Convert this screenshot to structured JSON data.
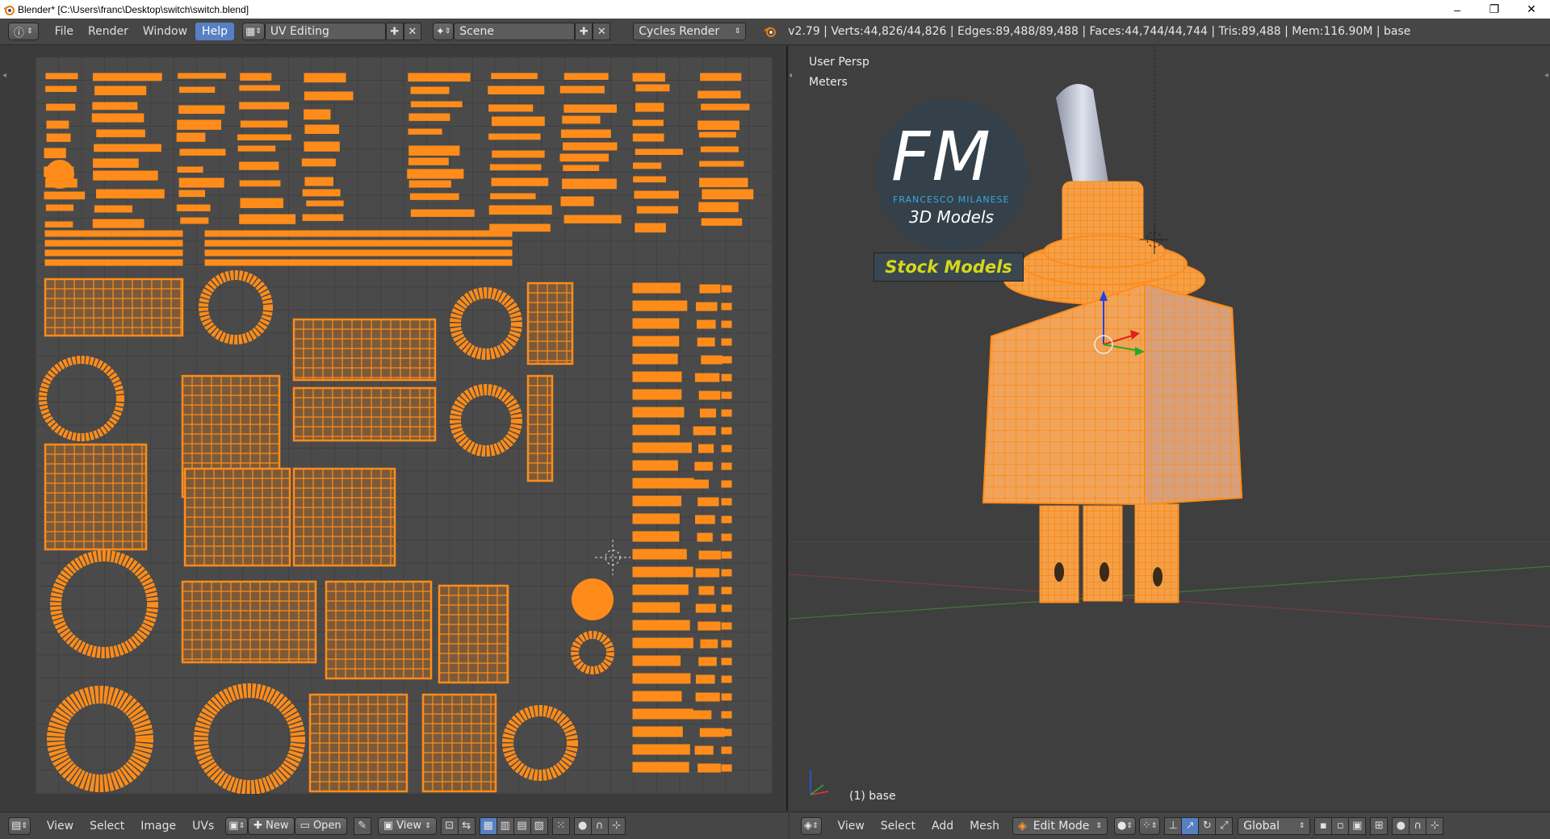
{
  "window": {
    "title": "Blender* [C:\\Users\\franc\\Desktop\\switch\\switch.blend]",
    "minimize": "–",
    "maximize": "❐",
    "close": "✕"
  },
  "info_header": {
    "menus": [
      "File",
      "Render",
      "Window",
      "Help"
    ],
    "active_menu": "Help",
    "screen_layout": "UV Editing",
    "scene": "Scene",
    "render_engine": "Cycles Render",
    "stats": "v2.79 | Verts:44,826/44,826 | Edges:89,488/89,488 | Faces:44,744/44,744 | Tris:89,488 | Mem:116.90M | base"
  },
  "uv_editor": {
    "menus": [
      "View",
      "Select",
      "Image",
      "UVs"
    ],
    "new_label": "New",
    "open_label": "Open",
    "view_label": "View"
  },
  "viewport": {
    "view_name": "User Persp",
    "units": "Meters",
    "object_label": "(1) base",
    "menus": [
      "View",
      "Select",
      "Add",
      "Mesh"
    ],
    "mode": "Edit Mode",
    "orientation": "Global",
    "logo": {
      "initials": "FM",
      "author": "FRANCESCO MILANESE",
      "subtitle": "3D Models",
      "banner": "Stock Models"
    }
  },
  "colors": {
    "uv_orange": "#ff8c1a",
    "accent_blue": "#5680c2",
    "logo_blue": "#3aa6e0",
    "banner_yellow": "#d6d81a"
  }
}
